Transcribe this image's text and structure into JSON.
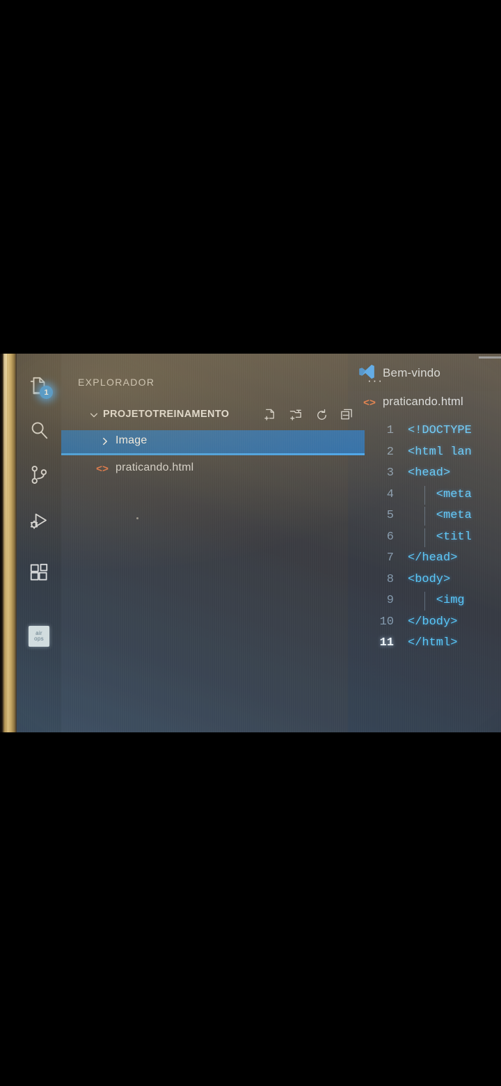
{
  "app": {
    "name": "Visual Studio Code",
    "theme": "dark"
  },
  "activity_bar": {
    "items": [
      {
        "name": "explorer",
        "icon": "files-icon",
        "badge": "1",
        "active": true
      },
      {
        "name": "search",
        "icon": "search-icon"
      },
      {
        "name": "source-control",
        "icon": "source-control-icon"
      },
      {
        "name": "run-and-debug",
        "icon": "run-debug-icon"
      },
      {
        "name": "extensions",
        "icon": "extensions-icon"
      },
      {
        "name": "air-ops",
        "icon": "air-ops-icon",
        "label_line1": "air",
        "label_line2": "ops"
      }
    ]
  },
  "sidebar": {
    "title": "EXPLORADOR",
    "more_actions": "···",
    "folder": {
      "name": "PROJETOTREINAMENTO",
      "expanded": true,
      "chevron": "chevron-down-icon"
    },
    "toolbar": [
      {
        "name": "new-file",
        "icon": "new-file-icon"
      },
      {
        "name": "new-folder",
        "icon": "new-folder-icon"
      },
      {
        "name": "refresh",
        "icon": "refresh-icon"
      },
      {
        "name": "collapse-all",
        "icon": "collapse-all-icon"
      }
    ],
    "tree": [
      {
        "name": "Image",
        "type": "folder",
        "expanded": false,
        "selected": true,
        "chevron": "chevron-right-icon"
      },
      {
        "name": "praticando.html",
        "type": "file",
        "icon": "html-icon",
        "selected": false
      }
    ]
  },
  "editor": {
    "tabs": [
      {
        "label": "Bem-vindo",
        "icon": "vscode-logo-icon",
        "active": true
      }
    ],
    "breadcrumb": {
      "icon": "html-icon",
      "label": "praticando.html"
    },
    "active_line": 11,
    "lines": [
      {
        "no": "1",
        "text": "<!DOCTYPE",
        "indent": false
      },
      {
        "no": "2",
        "text": "<html lan",
        "indent": false
      },
      {
        "no": "3",
        "text": "<head>",
        "indent": false
      },
      {
        "no": "4",
        "text": "    <meta",
        "indent": true
      },
      {
        "no": "5",
        "text": "    <meta",
        "indent": true
      },
      {
        "no": "6",
        "text": "    <titl",
        "indent": true
      },
      {
        "no": "7",
        "text": "</head>",
        "indent": false
      },
      {
        "no": "8",
        "text": "<body>",
        "indent": false
      },
      {
        "no": "9",
        "text": "    <img",
        "indent": true
      },
      {
        "no": "10",
        "text": "</body>",
        "indent": false
      },
      {
        "no": "11",
        "text": "</html>",
        "indent": false
      }
    ]
  },
  "colors": {
    "selection_blue": "#0c5ba6",
    "focus_border": "#2b9bf0",
    "badge_blue": "#1f8fe8",
    "html_icon_orange": "#e06a3a",
    "code_blue": "#4fc3f7",
    "sidebar_bg": "#313134",
    "activitybar_bg": "#2c2b2c",
    "editor_bg": "#2c2f36"
  }
}
